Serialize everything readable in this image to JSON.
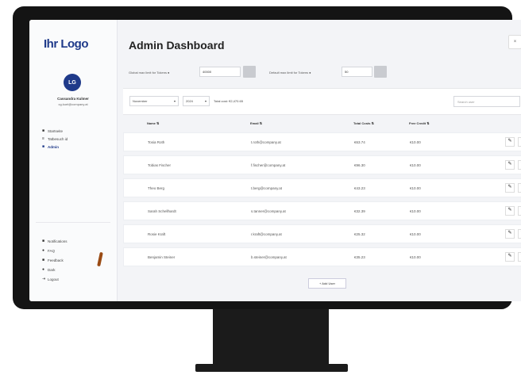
{
  "sidebar": {
    "logo": "Ihr Logo",
    "avatar_initials": "LG",
    "user_name": "Cassandra Kulmer",
    "user_email": "cg.kuel@company.at",
    "nav_top": [
      {
        "label": "Startseite",
        "icon": "home-icon",
        "glyph": "■"
      },
      {
        "label": "Tatbesuch id",
        "icon": "id-icon",
        "glyph": "≡"
      },
      {
        "label": "Admin",
        "icon": "admin-icon",
        "glyph": "■",
        "active": true
      }
    ],
    "nav_bottom": [
      {
        "label": "Notifications",
        "icon": "bell-icon",
        "glyph": "■"
      },
      {
        "label": "FAQ",
        "icon": "faq-icon",
        "glyph": "●"
      },
      {
        "label": "Feedback",
        "icon": "feedback-icon",
        "glyph": "■"
      },
      {
        "label": "Dark",
        "icon": "moon-icon",
        "glyph": "●"
      },
      {
        "label": "Logout",
        "icon": "logout-icon",
        "glyph": "⇥"
      }
    ]
  },
  "header": {
    "title": "Admin Dashboard",
    "close_glyph": "×"
  },
  "settings": {
    "global_label": "Global max limit for Tokens ●",
    "global_value": "40000",
    "default_label": "Default max limit for Tokens ●",
    "default_value": "50"
  },
  "toolbar": {
    "month": "November",
    "year": "2024",
    "total_cost": "Total cost: €2,470.65",
    "search_placeholder": "Search user"
  },
  "table": {
    "headers": [
      "Name ⇅",
      "Email ⇅",
      "Total Costs ⇅",
      "Free Credit ⇅"
    ],
    "rows": [
      {
        "name": "Tosia Roth",
        "email": "t.roth@company.at",
        "cost": "€63.74",
        "credit": "€10.00"
      },
      {
        "name": "Tobias Fischer",
        "email": "f.fischer@company.at",
        "cost": "€96.30",
        "credit": "€10.00"
      },
      {
        "name": "Theo Berg",
        "email": "t.berg@company.at",
        "cost": "€43.23",
        "credit": "€10.00"
      },
      {
        "name": "Sarah Schellhardt",
        "email": "s.tanner@company.at",
        "cost": "€32.39",
        "credit": "€10.00"
      },
      {
        "name": "Rosie Kraft",
        "email": "r.kraft@company.at",
        "cost": "€25.32",
        "credit": "€10.00"
      },
      {
        "name": "Benjamin Steiner",
        "email": "b.steiner@company.at",
        "cost": "€35.23",
        "credit": "€10.00"
      }
    ],
    "edit_glyph": "✎",
    "reset_glyph": "↻"
  },
  "add_button": "+ Add User"
}
